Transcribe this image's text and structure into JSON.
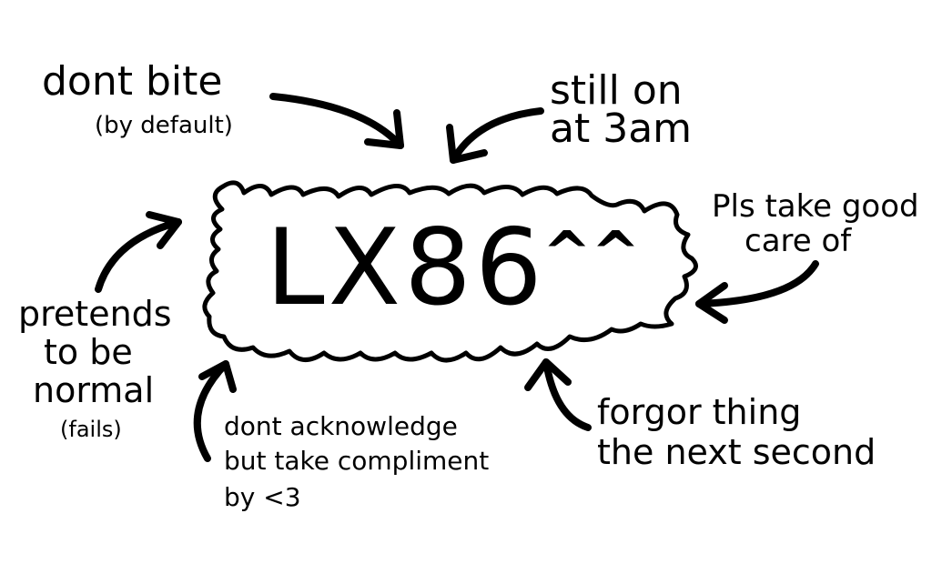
{
  "center": {
    "name": "LX86",
    "face": "^^"
  },
  "notes": {
    "top_left": {
      "main": "dont bite",
      "sub": "(by default)"
    },
    "top_right": {
      "line1": "still on",
      "line2": "at 3am"
    },
    "right": {
      "line1": "Pls take good",
      "line2": "care of"
    },
    "left": {
      "line1": "pretends",
      "line2": "to be",
      "line3": "normal",
      "sub": "(fails)"
    },
    "bottom_left": {
      "line1": "dont acknowledge",
      "line2": "but take compliment",
      "line3": "by <3"
    },
    "bottom_right": {
      "line1": "forgor thing",
      "line2": "the next second"
    }
  },
  "colors": {
    "ink": "#000000",
    "paper": "#ffffff"
  }
}
